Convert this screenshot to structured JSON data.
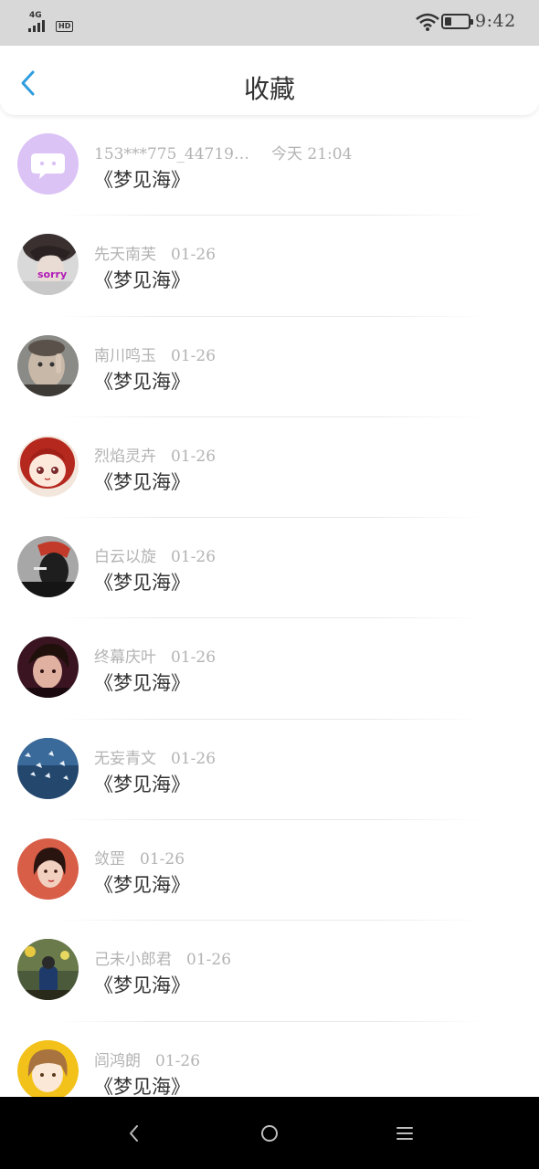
{
  "status_bar": {
    "network": "4G",
    "hd_label": "HD",
    "time": "9:42",
    "battery_level": 0.3
  },
  "header": {
    "title": "收藏",
    "back_icon": "chevron-left-icon"
  },
  "favorites": [
    {
      "user": "153***775_44719…",
      "date": "今天  21:04",
      "book": "《梦见海》",
      "avatar": "chat-bubble-icon"
    },
    {
      "user": "先天南芙",
      "date": "01-26",
      "book": "《梦见海》",
      "avatar": "user-avatar",
      "avatar_text": "sorry"
    },
    {
      "user": "南川鸣玉",
      "date": "01-26",
      "book": "《梦见海》",
      "avatar": "user-avatar"
    },
    {
      "user": "烈焰灵卉",
      "date": "01-26",
      "book": "《梦见海》",
      "avatar": "user-avatar"
    },
    {
      "user": "白云以旋",
      "date": "01-26",
      "book": "《梦见海》",
      "avatar": "user-avatar"
    },
    {
      "user": "终幕庆叶",
      "date": "01-26",
      "book": "《梦见海》",
      "avatar": "user-avatar"
    },
    {
      "user": "无妄青文",
      "date": "01-26",
      "book": "《梦见海》",
      "avatar": "user-avatar"
    },
    {
      "user": "敛罡",
      "date": "01-26",
      "book": "《梦见海》",
      "avatar": "user-avatar"
    },
    {
      "user": "己未小郎君",
      "date": "01-26",
      "book": "《梦见海》",
      "avatar": "user-avatar"
    },
    {
      "user": "闾鸿朗",
      "date": "01-26",
      "book": "《梦见海》",
      "avatar": "user-avatar"
    }
  ],
  "nav_bar": {
    "back": "nav-back-icon",
    "home": "nav-home-icon",
    "menu": "nav-menu-icon"
  },
  "colors": {
    "accent": "#2f9de0",
    "muted_text": "#b3b3b3",
    "body_text": "#333333",
    "chat_avatar": "#d9c1f5"
  }
}
